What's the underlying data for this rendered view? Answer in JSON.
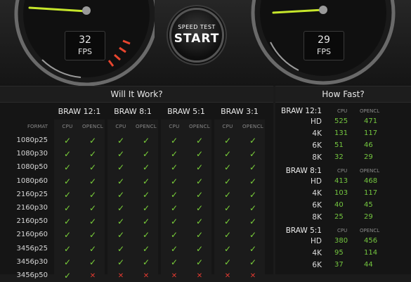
{
  "gauges": {
    "left": {
      "value": "32",
      "unit": "FPS"
    },
    "right": {
      "value": "29",
      "unit": "FPS"
    }
  },
  "start_button": {
    "line1": "SPEED TEST",
    "line2": "START"
  },
  "will_it_work": {
    "title": "Will It Work?",
    "format_label": "FORMAT",
    "groups": [
      "BRAW 12:1",
      "BRAW 8:1",
      "BRAW 5:1",
      "BRAW 3:1"
    ],
    "subcols": [
      "CPU",
      "OPENCL"
    ],
    "rows": [
      {
        "format": "1080p25",
        "cells": [
          "✓",
          "✓",
          "✓",
          "✓",
          "✓",
          "✓",
          "✓",
          "✓"
        ]
      },
      {
        "format": "1080p30",
        "cells": [
          "✓",
          "✓",
          "✓",
          "✓",
          "✓",
          "✓",
          "✓",
          "✓"
        ]
      },
      {
        "format": "1080p50",
        "cells": [
          "✓",
          "✓",
          "✓",
          "✓",
          "✓",
          "✓",
          "✓",
          "✓"
        ]
      },
      {
        "format": "1080p60",
        "cells": [
          "✓",
          "✓",
          "✓",
          "✓",
          "✓",
          "✓",
          "✓",
          "✓"
        ]
      },
      {
        "format": "2160p25",
        "cells": [
          "✓",
          "✓",
          "✓",
          "✓",
          "✓",
          "✓",
          "✓",
          "✓"
        ]
      },
      {
        "format": "2160p30",
        "cells": [
          "✓",
          "✓",
          "✓",
          "✓",
          "✓",
          "✓",
          "✓",
          "✓"
        ]
      },
      {
        "format": "2160p50",
        "cells": [
          "✓",
          "✓",
          "✓",
          "✓",
          "✓",
          "✓",
          "✓",
          "✓"
        ]
      },
      {
        "format": "2160p60",
        "cells": [
          "✓",
          "✓",
          "✓",
          "✓",
          "✓",
          "✓",
          "✓",
          "✓"
        ]
      },
      {
        "format": "3456p25",
        "cells": [
          "✓",
          "✓",
          "✓",
          "✓",
          "✓",
          "✓",
          "✓",
          "✓"
        ]
      },
      {
        "format": "3456p30",
        "cells": [
          "✓",
          "✓",
          "✓",
          "✓",
          "✓",
          "✓",
          "✓",
          "✓"
        ]
      },
      {
        "format": "3456p50",
        "cells": [
          "✓",
          "✕",
          "✕",
          "✕",
          "✕",
          "✕",
          "✕",
          "✕"
        ]
      }
    ]
  },
  "how_fast": {
    "title": "How Fast?",
    "groups": [
      {
        "name": "BRAW 12:1",
        "rows": [
          {
            "res": "HD",
            "cpu": "525",
            "opencl": "471"
          },
          {
            "res": "4K",
            "cpu": "131",
            "opencl": "117"
          },
          {
            "res": "6K",
            "cpu": "51",
            "opencl": "46"
          },
          {
            "res": "8K",
            "cpu": "32",
            "opencl": "29"
          }
        ]
      },
      {
        "name": "BRAW 8:1",
        "rows": [
          {
            "res": "HD",
            "cpu": "413",
            "opencl": "468"
          },
          {
            "res": "4K",
            "cpu": "103",
            "opencl": "117"
          },
          {
            "res": "6K",
            "cpu": "40",
            "opencl": "45"
          },
          {
            "res": "8K",
            "cpu": "25",
            "opencl": "29"
          }
        ]
      },
      {
        "name": "BRAW 5:1",
        "rows": [
          {
            "res": "HD",
            "cpu": "380",
            "opencl": "456"
          },
          {
            "res": "4K",
            "cpu": "95",
            "opencl": "114"
          },
          {
            "res": "6K",
            "cpu": "37",
            "opencl": "44"
          }
        ]
      }
    ]
  },
  "colors": {
    "ok": "#7bd13a",
    "fail": "#e23a30",
    "needle": "#c6e62b"
  }
}
